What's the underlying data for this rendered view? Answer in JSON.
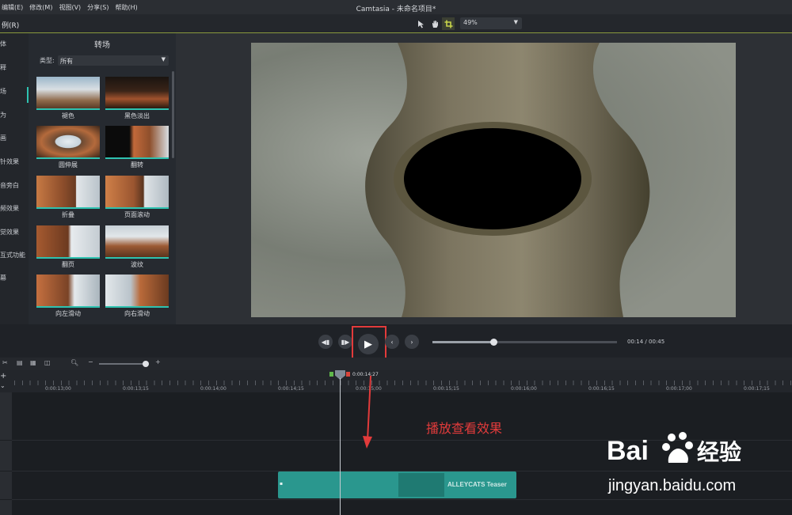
{
  "app": {
    "menu": [
      "编辑(E)",
      "修改(M)",
      "视图(V)",
      "分享(S)",
      "帮助(H)"
    ],
    "title": "Camtasia - 未命名项目*"
  },
  "toolbar": {
    "left_label": "例(R)",
    "zoom": "49%"
  },
  "categories": [
    "体",
    "释",
    "场",
    "为",
    "画",
    "针效果",
    "音旁白",
    "频效果",
    "觉效果",
    "互式功能",
    "幕"
  ],
  "panel": {
    "title": "转场",
    "type_label": "类型:",
    "type_value": "所有",
    "items": [
      "褪色",
      "黑色淡出",
      "圆伸展",
      "翻转",
      "折叠",
      "页面滚动",
      "翻页",
      "波纹",
      "向左滑动",
      "向右滑动"
    ]
  },
  "playback": {
    "current": "00:14",
    "separator": "/",
    "duration": "00:45",
    "progress": 0.33
  },
  "timeline": {
    "playhead_time": "0:00:14;27",
    "ticks": [
      "0:00:13;00",
      "0:00:13;15",
      "0:00:14;00",
      "0:00:14;15",
      "0:00:15;00",
      "0:00:15;15",
      "0:00:16;00",
      "0:00:16;15",
      "0:00:17;00",
      "0:00:17;15"
    ],
    "zoom_minus": "−",
    "zoom_plus": "+",
    "clip_label": "ALLEYCATS Teaser"
  },
  "annotation": {
    "text": "播放查看效果",
    "color": "#e23b3b"
  },
  "watermark": {
    "logo": "Bai  经验",
    "url": "jingyan.baidu.com"
  },
  "colors": {
    "accent": "#2ec2b0",
    "clip": "#2a978e",
    "highlight": "#e23b3b"
  }
}
